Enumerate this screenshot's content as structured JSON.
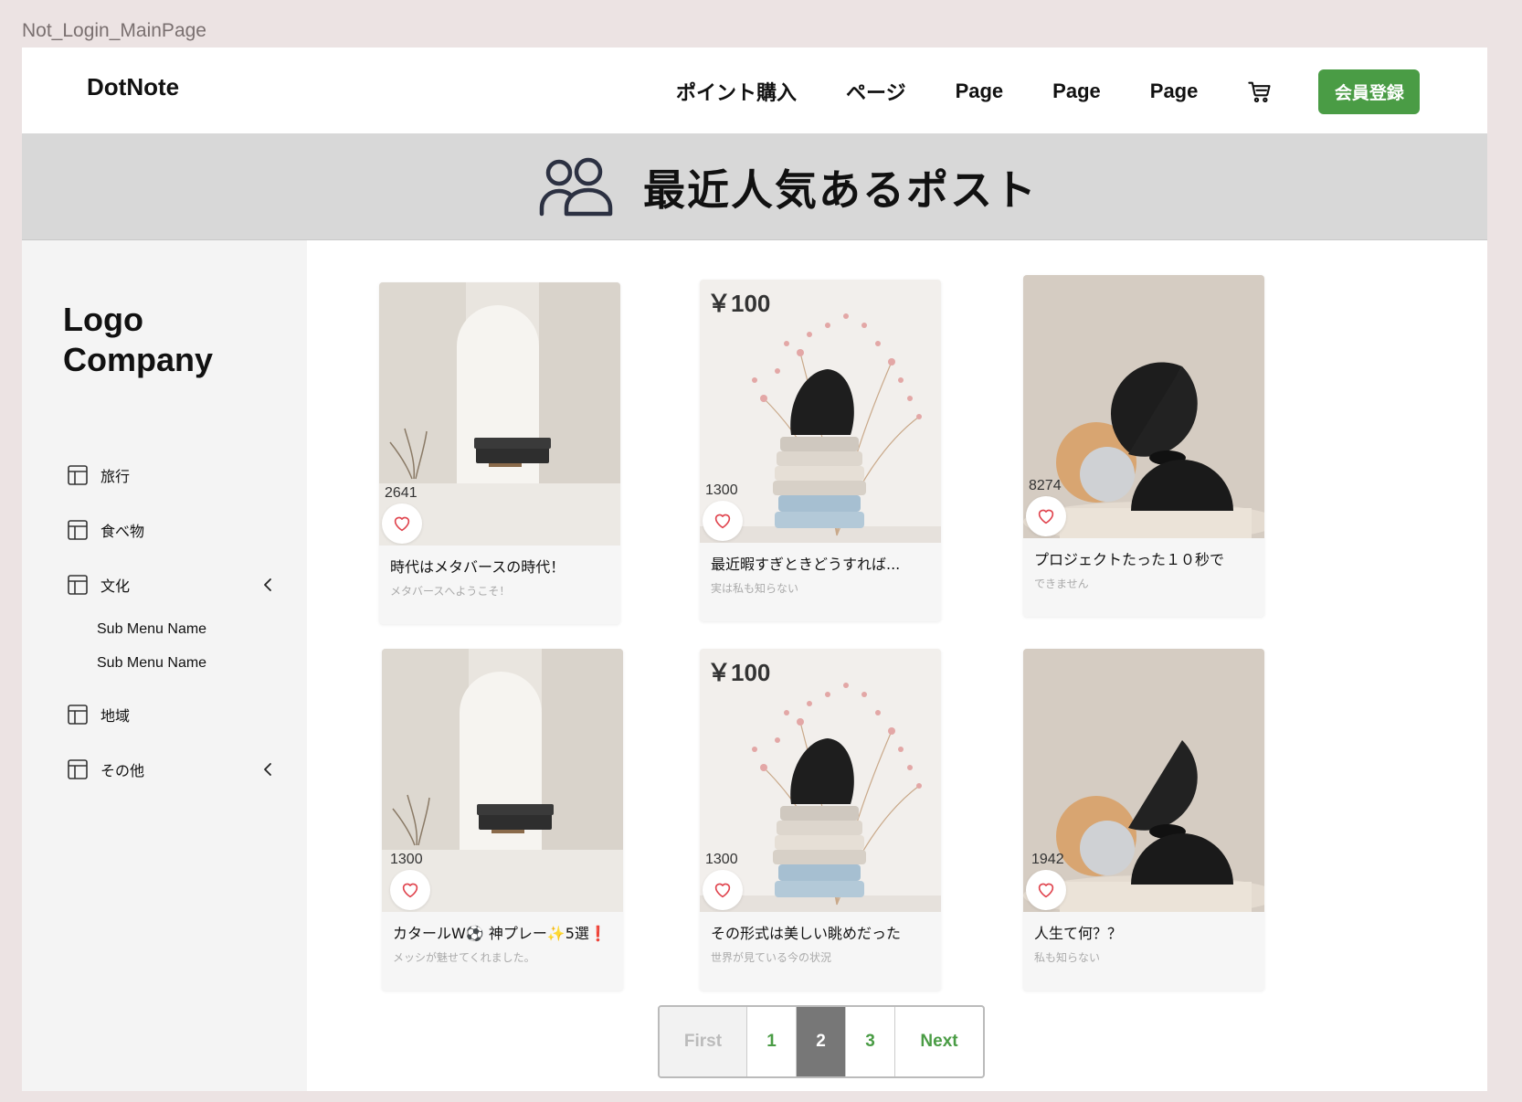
{
  "frame_label": "Not_Login_MainPage",
  "header": {
    "brand": "DotNote",
    "nav": [
      "ポイント購入",
      "ページ",
      "Page",
      "Page",
      "Page"
    ],
    "signup_label": "会員登録"
  },
  "banner": {
    "title": "最近人気あるポスト"
  },
  "sidebar": {
    "logo_line1": "Logo",
    "logo_line2": "Company",
    "items": [
      {
        "label": "旅行"
      },
      {
        "label": "食べ物"
      },
      {
        "label": "文化",
        "submenu": [
          "Sub Menu Name",
          "Sub Menu Name"
        ]
      },
      {
        "label": "地域"
      },
      {
        "label": "その他"
      }
    ]
  },
  "cards": [
    {
      "views": "2641",
      "title": "時代はメタバースの時代！",
      "subtitle": "メタバースへようこそ！",
      "image": "arch-room"
    },
    {
      "views": "1300",
      "price": "￥100",
      "title": "最近暇すぎときどうすれば...",
      "subtitle": "実は私も知らない",
      "image": "flowers-stack"
    },
    {
      "views": "8274",
      "title": "プロジェクトたった１０秒で",
      "subtitle": "できません",
      "image": "shapes"
    },
    {
      "views": "1300",
      "title": "カタールW⚽ 神プレー✨5選❗❗",
      "subtitle": "メッシが魅せてくれました。",
      "image": "arch-room"
    },
    {
      "views": "1300",
      "price": "￥100",
      "title": "その形式は美しい眺めだった",
      "subtitle": "世界が見ている今の状況",
      "image": "flowers-stack"
    },
    {
      "views": "1942",
      "title": "人生て何？？",
      "subtitle": "私も知らない",
      "image": "shapes"
    }
  ],
  "pagination": {
    "first": "First",
    "pages": [
      "1",
      "2",
      "3"
    ],
    "current": "2",
    "next": "Next"
  },
  "colors": {
    "accent": "#4a9c45",
    "like": "#e0444e",
    "banner": "#d8d8d8"
  }
}
